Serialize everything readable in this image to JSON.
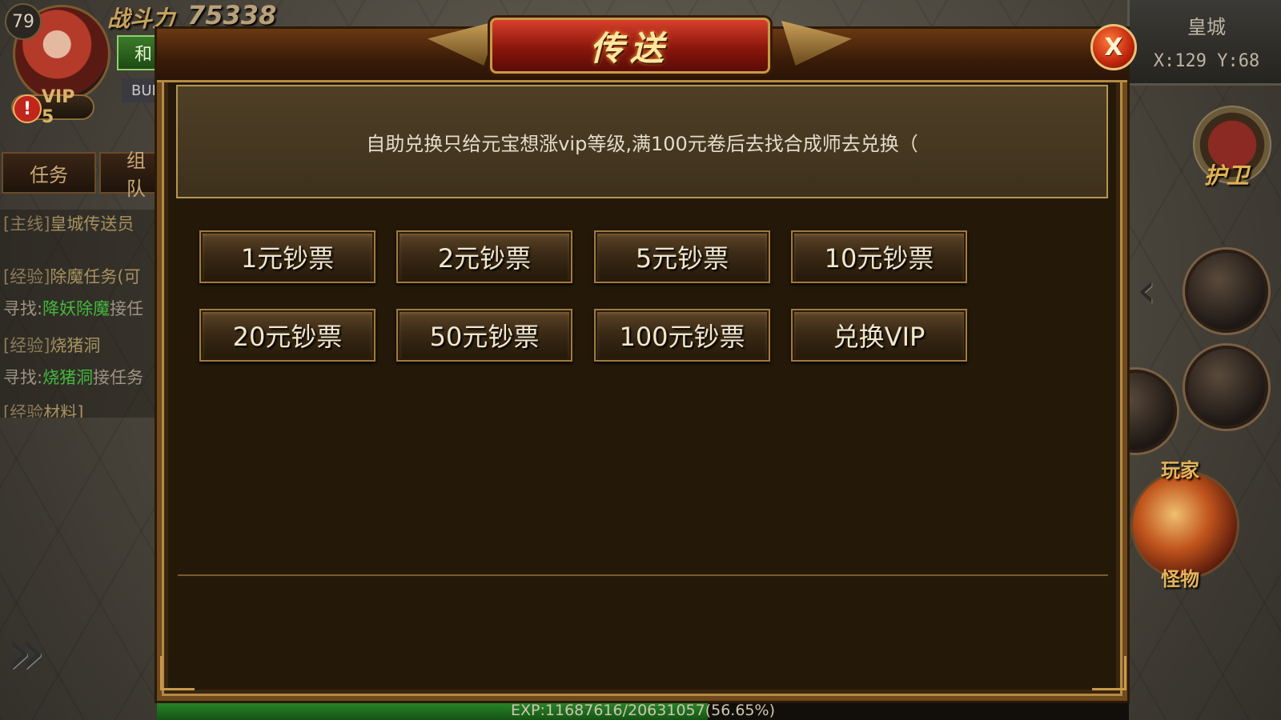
{
  "hud": {
    "level": "79",
    "power_label": "战斗力",
    "power_value": "75338",
    "mode_label": "和",
    "buff_label": "BUF",
    "vip_label": "VIP 5",
    "tabs": [
      "任务",
      "组队"
    ],
    "quests": [
      {
        "tag": "[主线]",
        "text": "皇城传送员"
      },
      {
        "tag": "[经验]",
        "text": "除魔任务(可"
      },
      {
        "prefix": "寻找:",
        "target": "降妖除魔",
        "suffix": "接任"
      },
      {
        "tag": "[经验]",
        "text": "烧猪洞"
      },
      {
        "prefix": "寻找:",
        "target": "烧猪洞",
        "suffix": "接任务"
      },
      {
        "tag": "[经验",
        "text": "材料]"
      }
    ],
    "map_name": "皇城",
    "coordinates": "X:129 Y:68",
    "guard_label": "护卫",
    "player_label": "玩家",
    "monster_label": "怪物",
    "exp_text": "EXP:11687616/20631057(56.65%)",
    "exp_fraction": 0.5665
  },
  "dialog": {
    "title": "传送",
    "close_label": "X",
    "notice": "自助兑换只给元宝想涨vip等级,满100元卷后去找合成师去兑换（",
    "buttons": [
      "1元钞票",
      "2元钞票",
      "5元钞票",
      "10元钞票",
      "20元钞票",
      "50元钞票",
      "100元钞票",
      "兑换VIP"
    ]
  },
  "colors": {
    "panel_bg": "#241909",
    "gold_border": "#b58a44",
    "title_red": "#8a160c",
    "button_text": "#f2e6cc",
    "quest_green": "#43b83b"
  }
}
